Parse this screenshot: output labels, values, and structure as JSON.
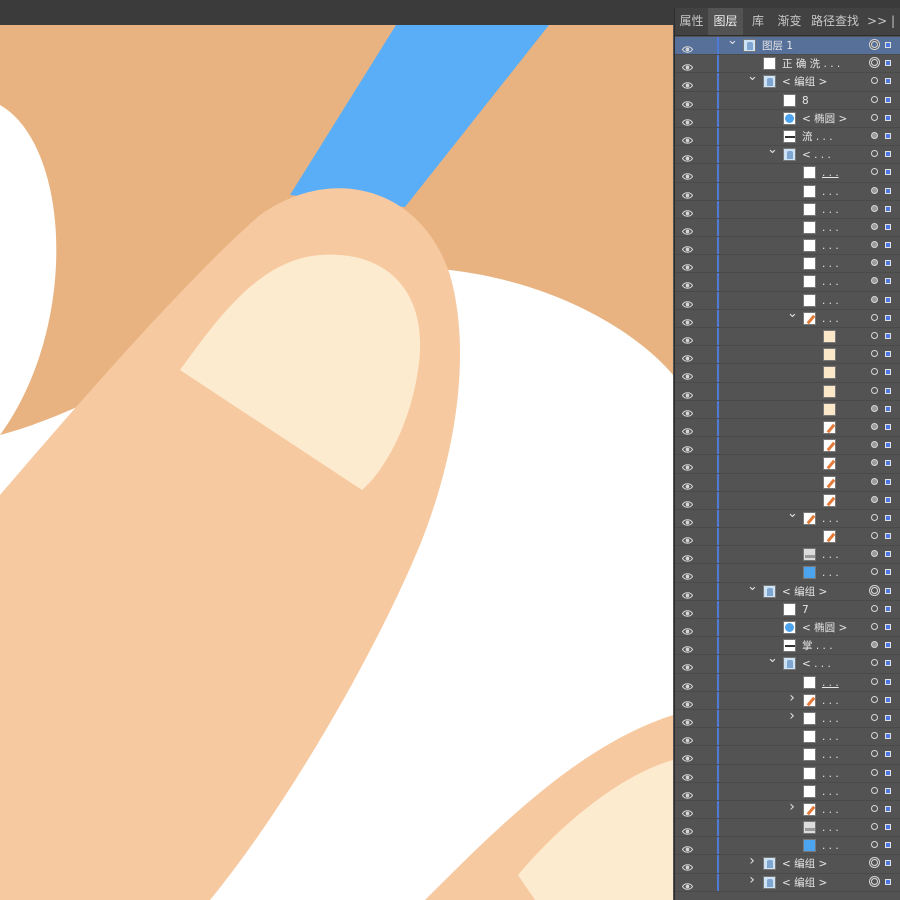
{
  "tabs": [
    {
      "label": "属性",
      "active": false
    },
    {
      "label": "图层",
      "active": true
    },
    {
      "label": "库",
      "active": false
    },
    {
      "label": "渐变",
      "active": false
    },
    {
      "label": "路径查找器",
      "active": false
    }
  ],
  "tab_more": ">> |",
  "colors": {
    "background": "#e8b380",
    "skin": "#f7c9a0",
    "nail": "#fdebcf",
    "stick": "#5aaef8",
    "paper": "#ffffff",
    "panel": "#535353",
    "selected_row": "#56709a",
    "layer_color": "#4c78e6"
  },
  "layers": [
    {
      "label": "图层 1",
      "depth": 0,
      "caret": "open",
      "thumb": "hand",
      "target": "double",
      "selected": true
    },
    {
      "label": "正 确 洗 . . .",
      "depth": 1,
      "caret": "",
      "thumb": "white",
      "target": "double"
    },
    {
      "label": "< 编组 >",
      "depth": 1,
      "caret": "open",
      "thumb": "hand",
      "target": "ring"
    },
    {
      "label": "8",
      "depth": 2,
      "caret": "",
      "thumb": "white",
      "target": "ring"
    },
    {
      "label": "< 椭圆 >",
      "depth": 2,
      "caret": "",
      "thumb": "circle",
      "target": "ring"
    },
    {
      "label": "流 . . .",
      "depth": 2,
      "caret": "",
      "thumb": "stroke",
      "target": "fill"
    },
    {
      "label": "< . . .",
      "depth": 2,
      "caret": "open",
      "thumb": "hand",
      "target": "ring"
    },
    {
      "label": ". . .",
      "depth": 3,
      "caret": "",
      "thumb": "white",
      "target": "ring",
      "underline": true
    },
    {
      "label": ". . .",
      "depth": 3,
      "caret": "",
      "thumb": "white",
      "target": "fill"
    },
    {
      "label": ". . .",
      "depth": 3,
      "caret": "",
      "thumb": "white",
      "target": "fill"
    },
    {
      "label": ". . .",
      "depth": 3,
      "caret": "",
      "thumb": "white",
      "target": "fill"
    },
    {
      "label": ". . .",
      "depth": 3,
      "caret": "",
      "thumb": "white",
      "target": "fill"
    },
    {
      "label": ". . .",
      "depth": 3,
      "caret": "",
      "thumb": "white",
      "target": "fill"
    },
    {
      "label": ". . .",
      "depth": 3,
      "caret": "",
      "thumb": "white",
      "target": "fill"
    },
    {
      "label": ". . .",
      "depth": 3,
      "caret": "",
      "thumb": "white",
      "target": "fill"
    },
    {
      "label": ". . .",
      "depth": 3,
      "caret": "open",
      "thumb": "orange",
      "target": "ring"
    },
    {
      "label": "",
      "depth": 4,
      "caret": "",
      "thumb": "cream",
      "target": "ring"
    },
    {
      "label": "",
      "depth": 4,
      "caret": "",
      "thumb": "cream",
      "target": "ring"
    },
    {
      "label": "",
      "depth": 4,
      "caret": "",
      "thumb": "cream",
      "target": "ring"
    },
    {
      "label": "",
      "depth": 4,
      "caret": "",
      "thumb": "cream",
      "target": "ring"
    },
    {
      "label": "",
      "depth": 4,
      "caret": "",
      "thumb": "cream",
      "target": "fill"
    },
    {
      "label": "",
      "depth": 4,
      "caret": "",
      "thumb": "orange",
      "target": "fill"
    },
    {
      "label": "",
      "depth": 4,
      "caret": "",
      "thumb": "orange",
      "target": "fill"
    },
    {
      "label": "",
      "depth": 4,
      "caret": "",
      "thumb": "orange",
      "target": "fill"
    },
    {
      "label": "",
      "depth": 4,
      "caret": "",
      "thumb": "orange",
      "target": "fill"
    },
    {
      "label": "",
      "depth": 4,
      "caret": "",
      "thumb": "orange",
      "target": "fill"
    },
    {
      "label": ". . .",
      "depth": 3,
      "caret": "open",
      "thumb": "orange",
      "target": "ring"
    },
    {
      "label": "",
      "depth": 4,
      "caret": "",
      "thumb": "orange",
      "target": "ring"
    },
    {
      "label": ". . .",
      "depth": 3,
      "caret": "",
      "thumb": "grey",
      "target": "fill"
    },
    {
      "label": ". . .",
      "depth": 3,
      "caret": "",
      "thumb": "blue",
      "target": "ring"
    },
    {
      "label": "< 编组 >",
      "depth": 1,
      "caret": "open",
      "thumb": "hand",
      "target": "double"
    },
    {
      "label": "7",
      "depth": 2,
      "caret": "",
      "thumb": "white",
      "target": "ring"
    },
    {
      "label": "< 椭圆 >",
      "depth": 2,
      "caret": "",
      "thumb": "circle",
      "target": "ring"
    },
    {
      "label": "掌 . . .",
      "depth": 2,
      "caret": "",
      "thumb": "stroke",
      "target": "fill"
    },
    {
      "label": "< . . .",
      "depth": 2,
      "caret": "open",
      "thumb": "hand",
      "target": "ring"
    },
    {
      "label": ". . .",
      "depth": 3,
      "caret": "",
      "thumb": "white",
      "target": "ring",
      "underline": true
    },
    {
      "label": ". . .",
      "depth": 3,
      "caret": "closed",
      "thumb": "orange",
      "target": "ring"
    },
    {
      "label": ". . .",
      "depth": 3,
      "caret": "closed",
      "thumb": "white",
      "target": "ring"
    },
    {
      "label": ". . .",
      "depth": 3,
      "caret": "",
      "thumb": "white",
      "target": "ring"
    },
    {
      "label": ". . .",
      "depth": 3,
      "caret": "",
      "thumb": "white",
      "target": "ring"
    },
    {
      "label": ". . .",
      "depth": 3,
      "caret": "",
      "thumb": "white",
      "target": "ring"
    },
    {
      "label": ". . .",
      "depth": 3,
      "caret": "",
      "thumb": "white",
      "target": "ring"
    },
    {
      "label": ". . .",
      "depth": 3,
      "caret": "closed",
      "thumb": "orange",
      "target": "ring"
    },
    {
      "label": ". . .",
      "depth": 3,
      "caret": "",
      "thumb": "grey",
      "target": "ring"
    },
    {
      "label": ". . .",
      "depth": 3,
      "caret": "",
      "thumb": "blue",
      "target": "ring"
    },
    {
      "label": "< 编组 >",
      "depth": 1,
      "caret": "closed",
      "thumb": "hand",
      "target": "double"
    },
    {
      "label": "< 编组 >",
      "depth": 1,
      "caret": "closed",
      "thumb": "hand",
      "target": "double"
    }
  ]
}
